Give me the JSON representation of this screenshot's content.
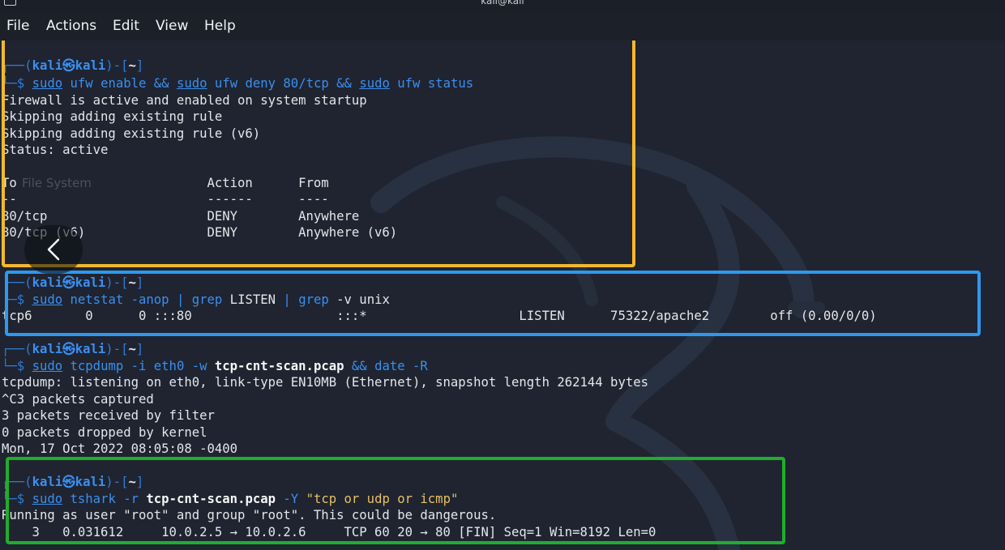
{
  "window": {
    "title": "kali@kali"
  },
  "menu": [
    "File",
    "Actions",
    "Edit",
    "View",
    "Help"
  ],
  "desktop_label": "File System",
  "prompt": {
    "user": "kali",
    "sep": "㉿",
    "host": "kali",
    "dir": "~"
  },
  "block1": {
    "cmd": {
      "s1": "sudo",
      "a1": " ufw enable ",
      "op1": "&&",
      "s2": "sudo",
      "a2": " ufw deny 80/tcp ",
      "op2": "&&",
      "s3": "sudo",
      "a3": " ufw status"
    },
    "out": [
      "Firewall is active and enabled on system startup",
      "Skipping adding existing rule",
      "Skipping adding existing rule (v6)",
      "Status: active",
      "",
      "To                         Action      From",
      "--                         ------      ----",
      "80/tcp                     DENY        Anywhere",
      "80/tcp (v6)                DENY        Anywhere (v6)"
    ]
  },
  "block2": {
    "cmd": {
      "s1": "sudo",
      "a1": " netstat -anop ",
      "op1": "|",
      "g1": "grep",
      "a2": " LISTEN ",
      "op2": "|",
      "g2": "grep",
      "a3": " -v unix"
    },
    "out": [
      "tcp6       0      0 :::80                   :::*                    LISTEN      75322/apache2        off (0.00/0/0)"
    ]
  },
  "block3": {
    "cmd": {
      "s1": "sudo",
      "a1": " tcpdump -i eth0 -w ",
      "file": "tcp-cnt-scan.pcap",
      "op1": " && ",
      "d": "date",
      "a2": " -R"
    },
    "out": [
      "tcpdump: listening on eth0, link-type EN10MB (Ethernet), snapshot length 262144 bytes",
      "^C3 packets captured",
      "3 packets received by filter",
      "0 packets dropped by kernel",
      "Mon, 17 Oct 2022 08:05:08 -0400"
    ]
  },
  "block4": {
    "cmd": {
      "s1": "sudo",
      "a1": " tshark -r ",
      "file": "tcp-cnt-scan.pcap",
      "a2": " -Y ",
      "q": "\"tcp or udp or icmp\""
    },
    "out": [
      "Running as user \"root\" and group \"root\". This could be dangerous.",
      "    3   0.031612     10.0.2.5 → 10.0.2.6     TCP 60 20 → 80 [FIN] Seq=1 Win=8192 Len=0"
    ]
  },
  "colors": {
    "highlight_yellow": "#f5b82e",
    "highlight_blue": "#2e98f0",
    "highlight_green": "#20ad2c",
    "prompt_blue": "#2f7bd6"
  },
  "icons": {
    "back": "chevron-left-icon",
    "window": "window-icon"
  }
}
